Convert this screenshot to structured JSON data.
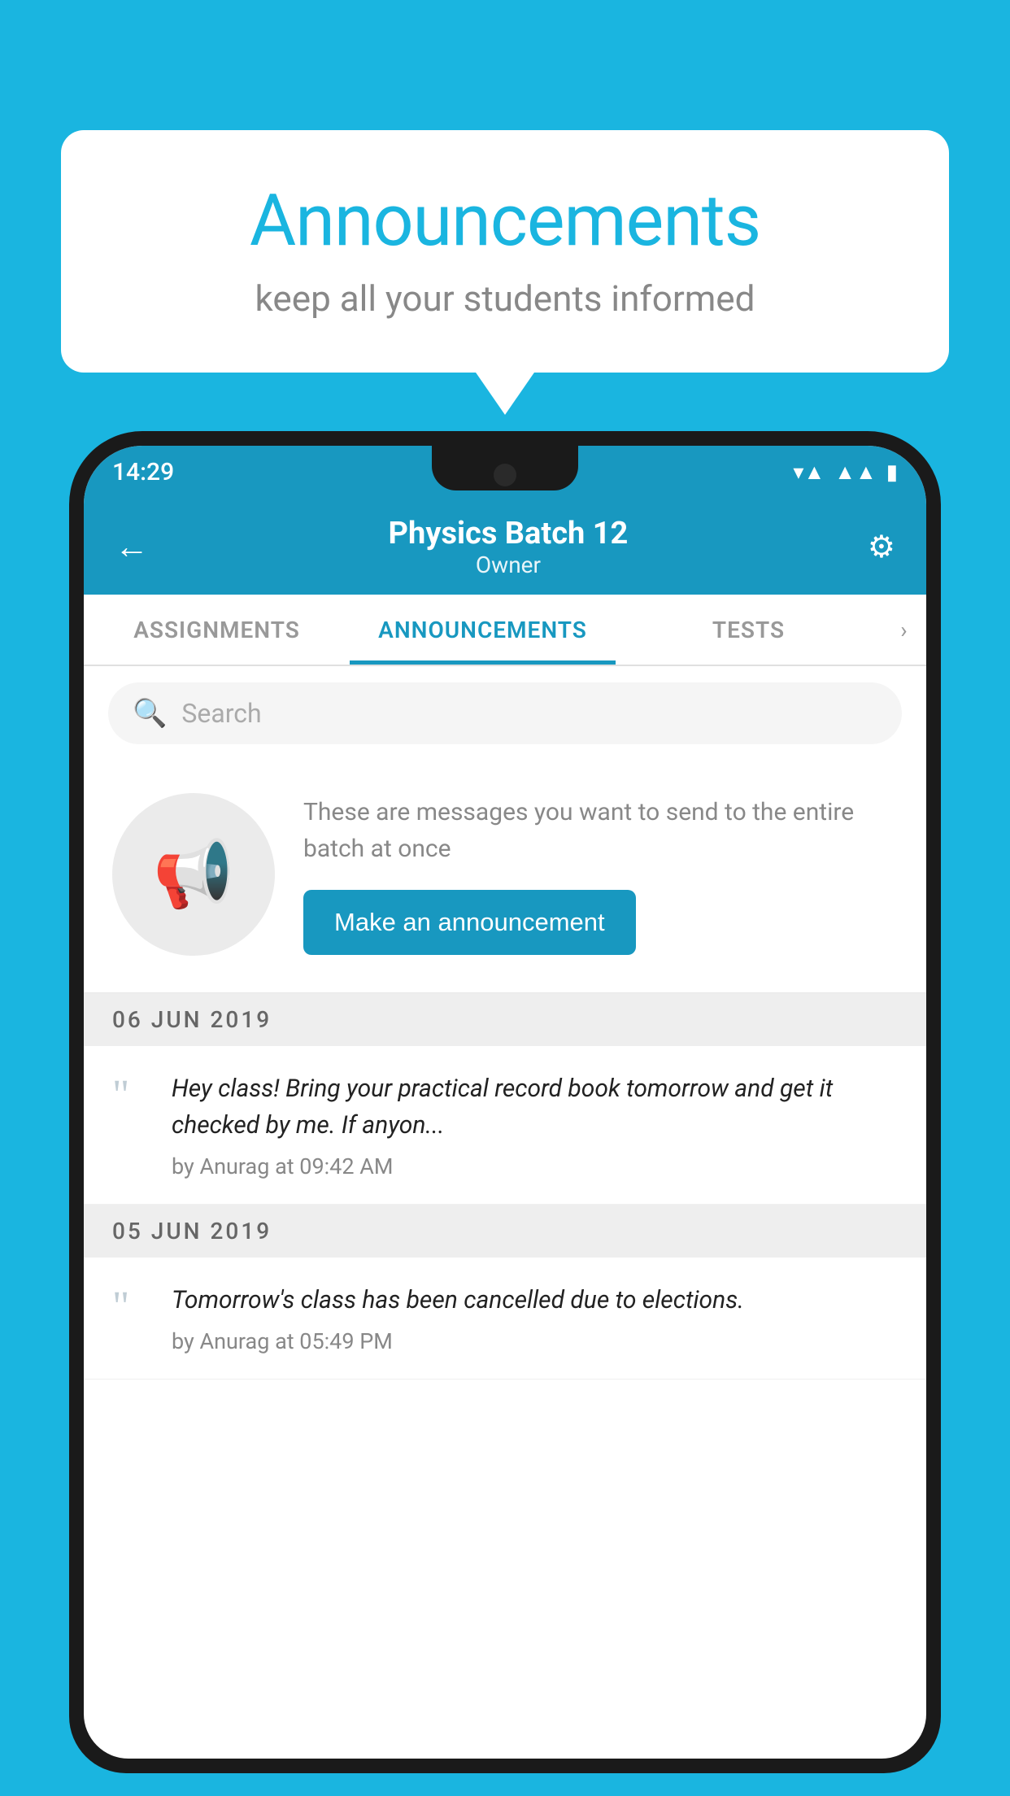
{
  "page": {
    "background_color": "#1ab5e0"
  },
  "speech_bubble": {
    "title": "Announcements",
    "subtitle": "keep all your students informed"
  },
  "status_bar": {
    "time": "14:29",
    "icons": [
      "wifi",
      "signal",
      "battery"
    ]
  },
  "header": {
    "back_label": "←",
    "title": "Physics Batch 12",
    "subtitle": "Owner",
    "settings_label": "⚙"
  },
  "tabs": [
    {
      "label": "ASSIGNMENTS",
      "active": false
    },
    {
      "label": "ANNOUNCEMENTS",
      "active": true
    },
    {
      "label": "TESTS",
      "active": false
    }
  ],
  "tabs_more": "›",
  "search": {
    "placeholder": "Search"
  },
  "announcement_prompt": {
    "description": "These are messages you want to send to the entire batch at once",
    "button_label": "Make an announcement"
  },
  "date_groups": [
    {
      "date": "06  JUN  2019",
      "items": [
        {
          "text": "Hey class! Bring your practical record book tomorrow and get it checked by me. If anyon...",
          "meta": "by Anurag at 09:42 AM"
        }
      ]
    },
    {
      "date": "05  JUN  2019",
      "items": [
        {
          "text": "Tomorrow's class has been cancelled due to elections.",
          "meta": "by Anurag at 05:49 PM"
        }
      ]
    }
  ]
}
